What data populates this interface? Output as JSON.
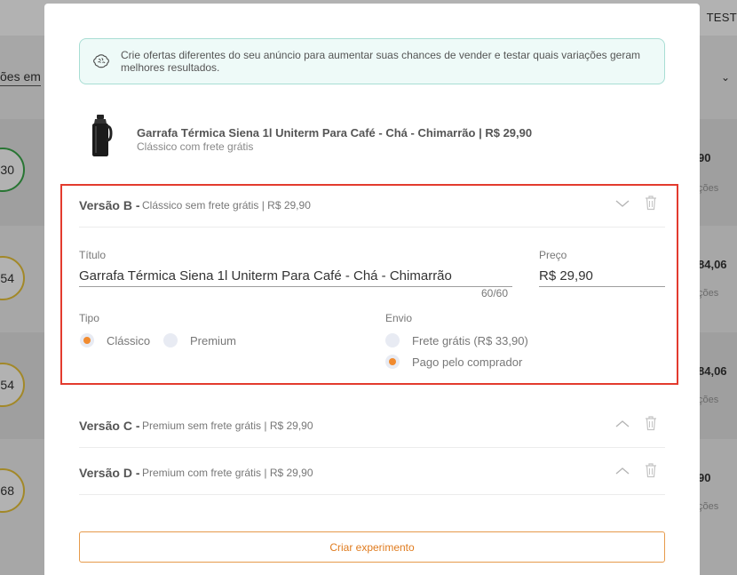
{
  "background": {
    "top_right_label": "TEST",
    "filter_label": "ões em",
    "rows": [
      {
        "score": "30",
        "ring_color": "#3aa84a",
        "price": "90",
        "sub": "ções"
      },
      {
        "score": "54",
        "ring_color": "#e8c33a",
        "price": "84,06",
        "sub": "ções"
      },
      {
        "score": "54",
        "ring_color": "#e8c33a",
        "price": "84,06",
        "sub": "ções"
      },
      {
        "score": "68",
        "ring_color": "#e8c33a",
        "price": "90",
        "sub": "ções"
      }
    ]
  },
  "tip": {
    "icon": "brain-icon",
    "text": "Crie ofertas diferentes do seu anúncio para aumentar suas chances de vender e testar quais variações geram melhores resultados."
  },
  "product": {
    "name": "Garrafa Térmica Siena 1l Uniterm Para Café - Chá - Chimarrão | R$ 29,90",
    "subtitle": "Clássico com frete grátis"
  },
  "versions": [
    {
      "title": "Versão B -",
      "description": "Clássico sem frete grátis | R$ 29,90",
      "expanded": true
    },
    {
      "title": "Versão C -",
      "description": "Premium sem frete grátis | R$ 29,90",
      "expanded": false
    },
    {
      "title": "Versão D -",
      "description": "Premium com frete grátis | R$ 29,90",
      "expanded": false
    }
  ],
  "form": {
    "title_label": "Título",
    "title_value": "Garrafa Térmica Siena 1l Uniterm Para Café - Chá - Chimarrão",
    "title_counter": "60/60",
    "price_label": "Preço",
    "price_value": "R$ 29,90",
    "type_label": "Tipo",
    "type_options": [
      "Clássico",
      "Premium"
    ],
    "type_selected": "Clássico",
    "shipping_label": "Envio",
    "shipping_options": [
      "Frete grátis (R$ 33,90)",
      "Pago pelo comprador"
    ],
    "shipping_selected": "Pago pelo comprador"
  },
  "actions": {
    "create_label": "Criar experimento"
  },
  "colors": {
    "accent": "#f18b2f",
    "highlight": "#e33b2e",
    "tip_bg": "#eefaf8",
    "tip_border": "#a8ded4"
  }
}
